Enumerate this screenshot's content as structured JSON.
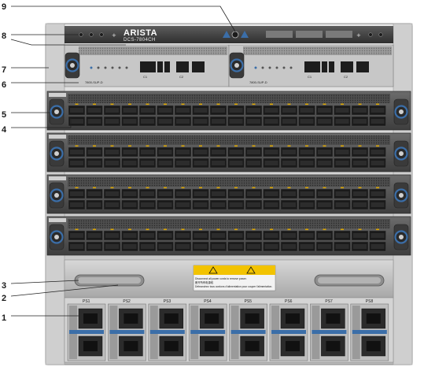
{
  "callouts": [
    "9",
    "8",
    "7",
    "6",
    "5",
    "4",
    "3",
    "2",
    "1"
  ],
  "header": {
    "brand": "ARISTA",
    "model": "DCS-7804CH"
  },
  "supervisor": {
    "label": "7800-SUP-D",
    "ports": [
      "C1",
      "C2"
    ]
  },
  "linecard_count": 4,
  "power_supplies": [
    "PS1",
    "PS2",
    "PS3",
    "PS4",
    "PS5",
    "PS6",
    "PS7",
    "PS8"
  ],
  "warning_label": [
    "Disconnect all power cords to remove power.",
    "断开所有电源线",
    "Débranchez tous cordons d'alimentation pour couper l'alimentation."
  ],
  "colors": {
    "chassis": "#4a4a4a",
    "accent_blue": "#3b6ea8",
    "port_dark": "#1f1f1f",
    "tray_light": "#c9c9c9"
  }
}
